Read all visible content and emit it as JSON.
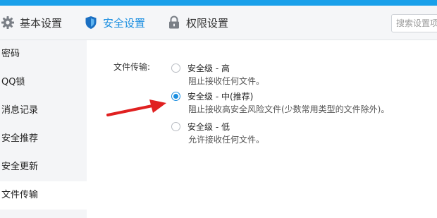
{
  "tabs": [
    {
      "label": "基本设置",
      "icon": "gear-icon"
    },
    {
      "label": "安全设置",
      "icon": "shield-icon",
      "active": true
    },
    {
      "label": "权限设置",
      "icon": "lock-icon"
    }
  ],
  "search": {
    "placeholder": "搜索设置项"
  },
  "sidebar": {
    "items": [
      {
        "label": "密码"
      },
      {
        "label": "QQ锁"
      },
      {
        "label": "消息记录"
      },
      {
        "label": "安全推荐"
      },
      {
        "label": "安全更新"
      },
      {
        "label": "文件传输",
        "active": true
      }
    ]
  },
  "file_transfer": {
    "label": "文件传输:",
    "selected": "medium",
    "options": [
      {
        "title": "安全级 - 高",
        "desc": "阻止接收任何文件。"
      },
      {
        "title": "安全级 - 中(推荐)",
        "desc": "阻止接收高安全风险文件(少数常用类型的文件除外)。"
      },
      {
        "title": "安全级 - 低",
        "desc": "允许接收任何文件。"
      }
    ]
  },
  "colors": {
    "accent": "#1a8ee0",
    "title_strip": "#1aa0ea",
    "annotation_arrow": "#e02020"
  }
}
